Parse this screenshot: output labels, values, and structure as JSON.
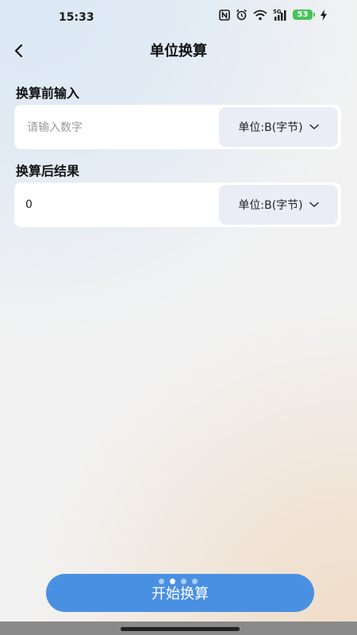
{
  "status_bar": {
    "time": "15:33",
    "network": "5G",
    "battery": "53",
    "icons": [
      "nfc-icon",
      "alarm-icon",
      "wifi-icon",
      "signal-5g-icon",
      "battery-icon",
      "charging-icon"
    ]
  },
  "header": {
    "title": "单位换算",
    "back_icon": "chevron-left-icon"
  },
  "input_section": {
    "label": "换算前输入",
    "placeholder": "请输入数字",
    "value": "",
    "unit": "单位:B(字节)"
  },
  "result_section": {
    "label": "换算后结果",
    "value": "0",
    "unit": "单位:B(字节)"
  },
  "footer": {
    "start_label": "开始换算",
    "page_indicator": {
      "count": 4,
      "active_index": 1
    }
  },
  "colors": {
    "accent": "#4a90e2",
    "battery": "#46c35a",
    "select_bg": "#eaedf5"
  }
}
